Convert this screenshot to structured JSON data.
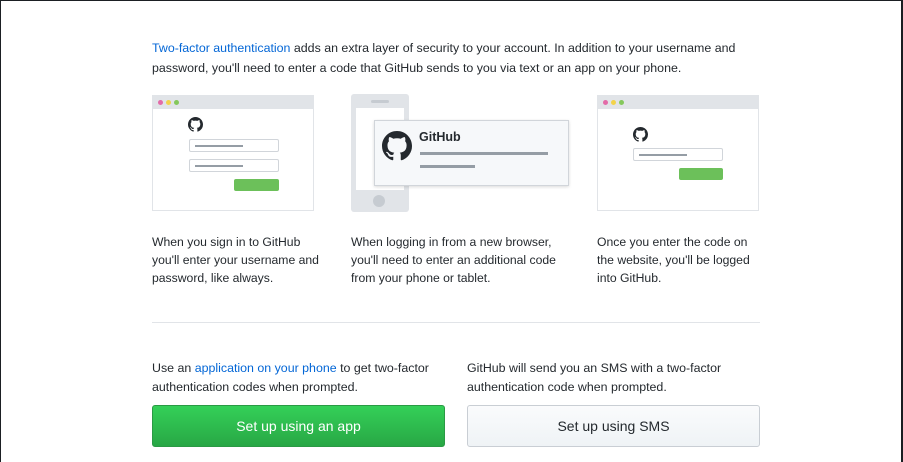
{
  "intro": {
    "link_text": "Two-factor authentication",
    "text_after_link": " adds an extra layer of security to your account. In addition to your username and password, you'll need to enter a code that GitHub sends to you via text or an app on your phone."
  },
  "illustrations": {
    "notification_title": "GitHub",
    "logo_icon": "github-octocat-icon"
  },
  "steps": [
    {
      "caption": "When you sign in to GitHub you'll enter your username and password, like always."
    },
    {
      "caption": "When logging in from a new browser, you'll need to enter an additional code from your phone or tablet."
    },
    {
      "caption": "Once you enter the code on the website, you'll be logged into GitHub."
    }
  ],
  "options": {
    "app": {
      "desc_before": "Use an ",
      "desc_link": "application on your phone",
      "desc_after": " to get two-factor authentication codes when prompted.",
      "button_label": "Set up using an app"
    },
    "sms": {
      "desc": "GitHub will send you an SMS with a two-factor authentication code when prompted.",
      "button_label": "Set up using SMS"
    }
  },
  "colors": {
    "link": "#0366d6",
    "primary_button": "#2ea44f",
    "illustration_green": "#6cc05a"
  }
}
